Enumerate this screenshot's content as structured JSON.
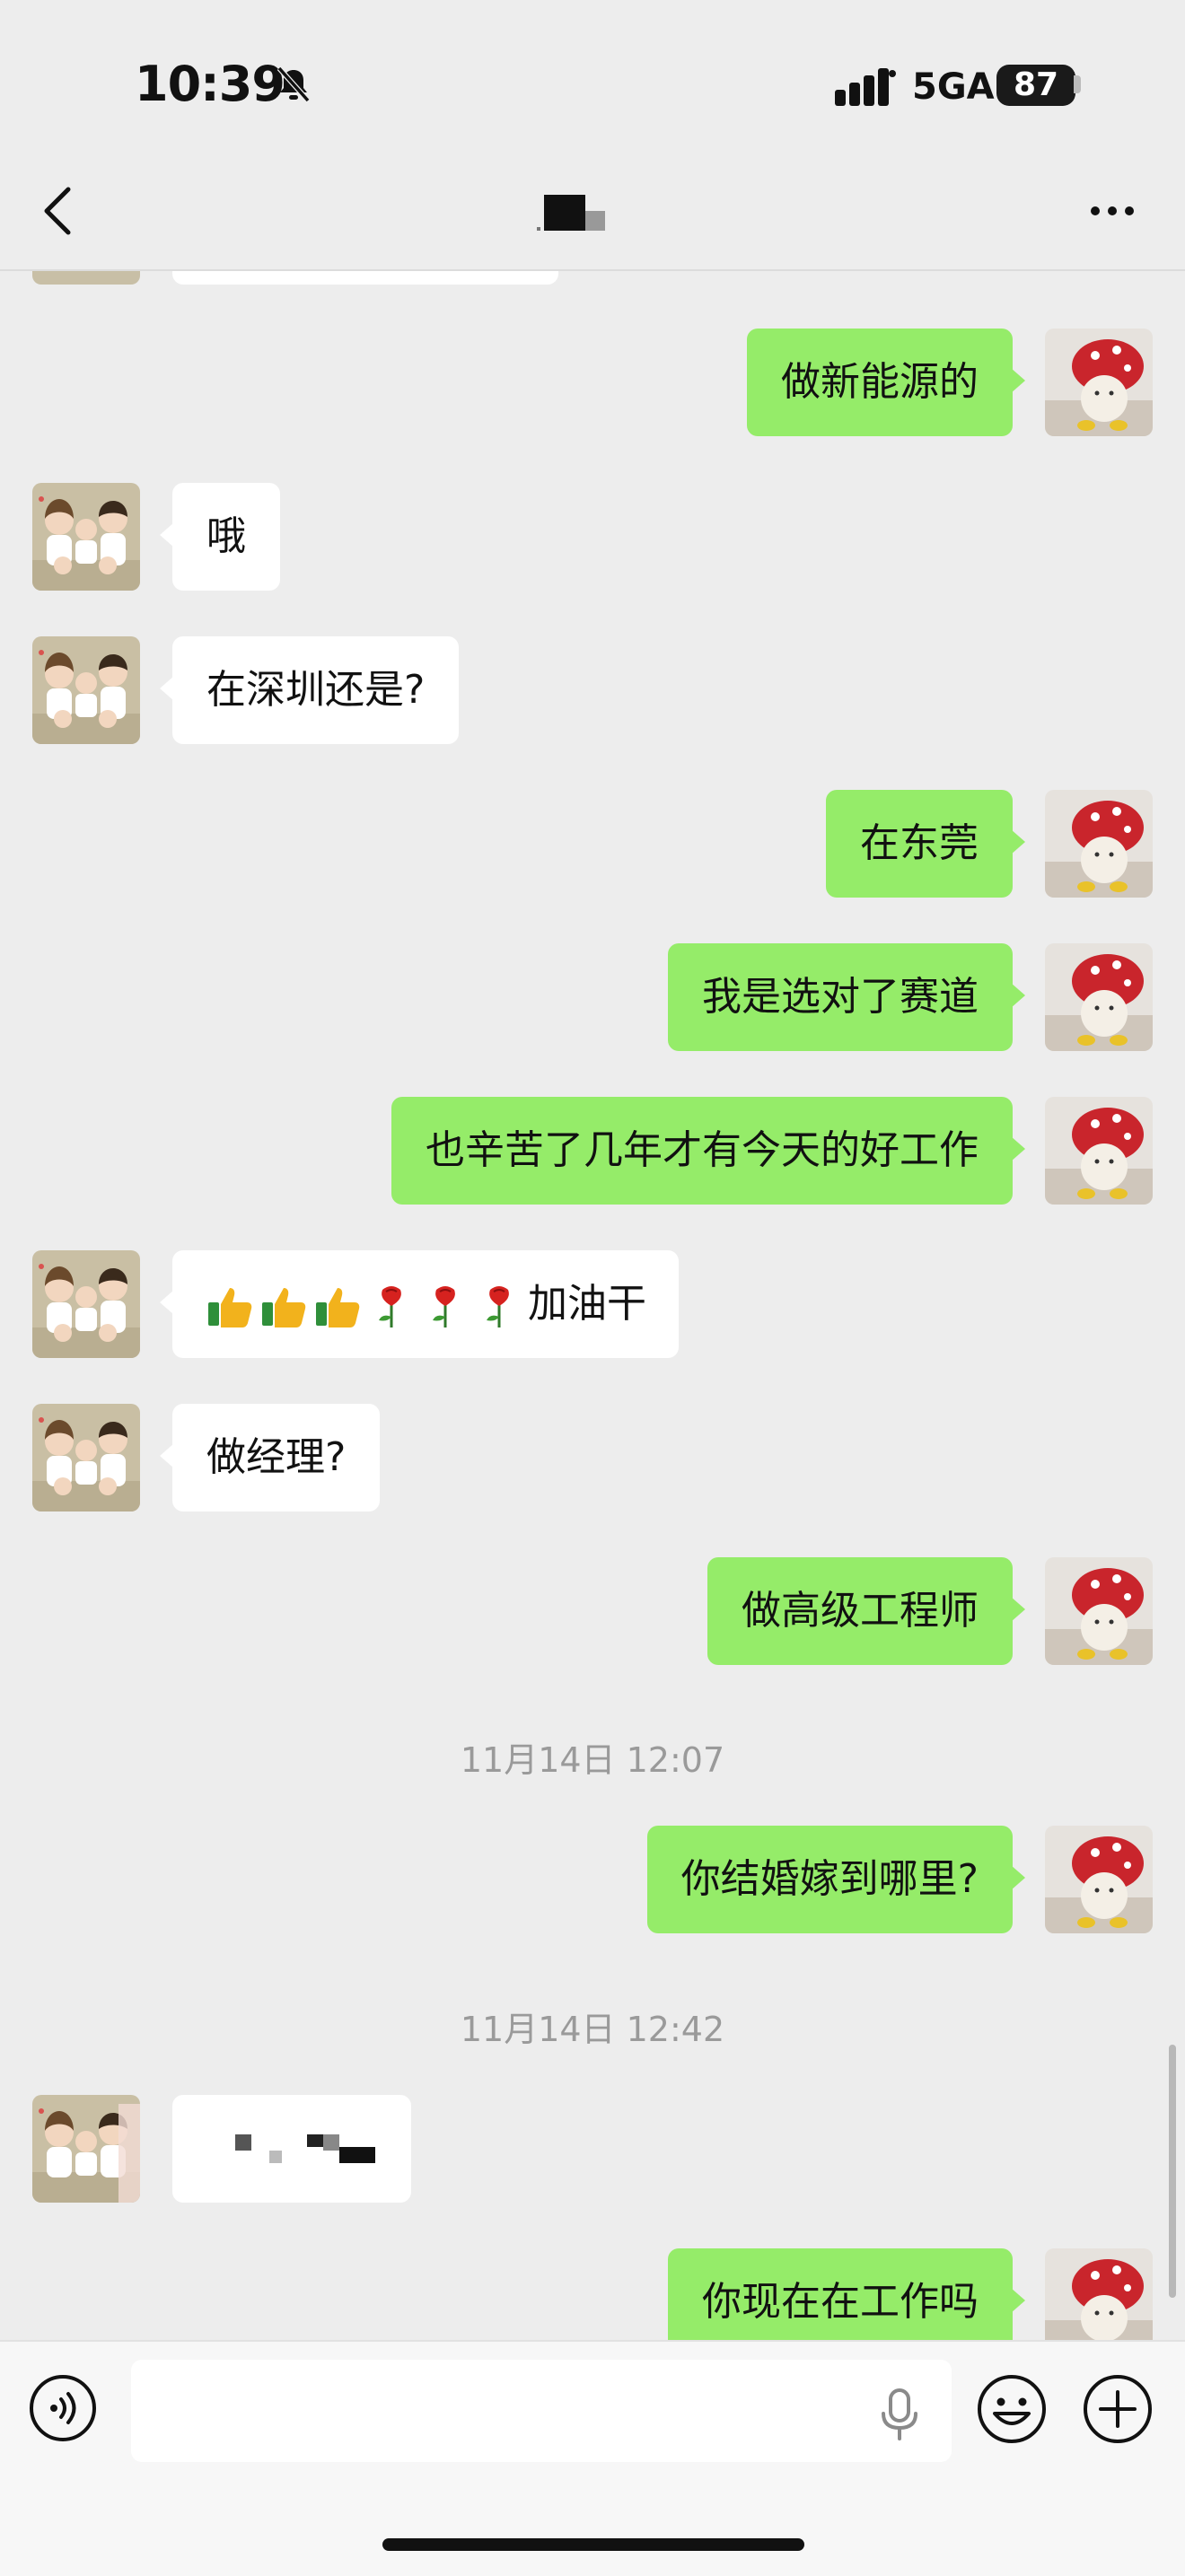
{
  "status_bar": {
    "time": "10:39",
    "network": "5GA",
    "battery": "87"
  },
  "nav": {
    "title": ""
  },
  "messages": [
    {
      "side": "out",
      "text": "做新能源的"
    },
    {
      "side": "in",
      "text": "哦"
    },
    {
      "side": "in",
      "text": "在深圳还是?"
    },
    {
      "side": "out",
      "text": "在东莞"
    },
    {
      "side": "out",
      "text": "我是选对了赛道"
    },
    {
      "side": "out",
      "text": "也辛苦了几年才有今天的好工作"
    },
    {
      "side": "in",
      "text": "加油干",
      "emoji": [
        "thumbs-up",
        "thumbs-up",
        "thumbs-up",
        "rose",
        "rose",
        "rose"
      ]
    },
    {
      "side": "in",
      "text": "做经理?"
    },
    {
      "side": "out",
      "text": "做高级工程师"
    },
    {
      "type": "time",
      "text": "11月14日 12:07"
    },
    {
      "side": "out",
      "text": "你结婚嫁到哪里?"
    },
    {
      "type": "time",
      "text": "11月14日 12:42"
    },
    {
      "side": "in",
      "text": "",
      "redacted": true
    },
    {
      "side": "out",
      "text": "你现在在工作吗"
    }
  ],
  "input": {
    "placeholder": ""
  },
  "colors": {
    "background": "#ededed",
    "outgoing_bubble": "#95ec69",
    "incoming_bubble": "#ffffff"
  }
}
